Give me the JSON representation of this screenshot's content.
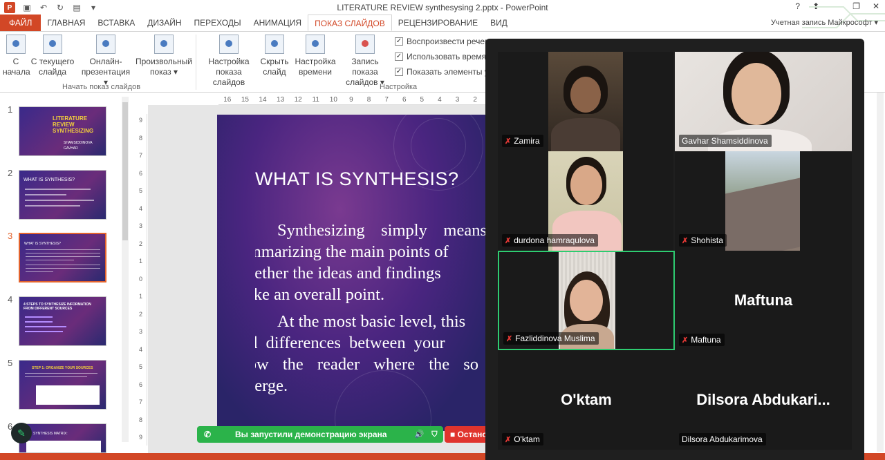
{
  "window": {
    "title": "LITERATURE REVIEW synthesysing 2.pptx - PowerPoint",
    "help": "?",
    "minimize": "—",
    "restore": "❐",
    "close": "✕",
    "logo": "P"
  },
  "tabs": {
    "file": "ФАЙЛ",
    "items": [
      "ГЛАВНАЯ",
      "ВСТАВКА",
      "ДИЗАЙН",
      "ПЕРЕХОДЫ",
      "АНИМАЦИЯ",
      "ПОКАЗ СЛАЙДОВ",
      "РЕЦЕНЗИРОВАНИЕ",
      "ВИД"
    ],
    "account": "Учетная запись Майкрософт ▾"
  },
  "ribbon": {
    "start": {
      "line1": "С",
      "line2": "начала"
    },
    "current": {
      "line1": "С текущего",
      "line2": "слайда"
    },
    "online": {
      "line1": "Онлайн-",
      "line2": "презентация ▾"
    },
    "custom": {
      "line1": "Произвольный",
      "line2": "показ ▾"
    },
    "setup": {
      "line1": "Настройка",
      "line2": "показа слайдов"
    },
    "hide": {
      "line1": "Скрыть",
      "line2": "слайд"
    },
    "timing": {
      "line1": "Настройка",
      "line2": "времени"
    },
    "record": {
      "line1": "Запись показа",
      "line2": "слайдов ▾"
    },
    "group_start": "Начать показ слайдов",
    "group_setup": "Настройка",
    "check1": "Воспроизвести речевое",
    "check2": "Использовать время",
    "check3": "Показать элементы управления"
  },
  "thumbnails": [
    {
      "num": "1",
      "title": "LITERATURE REVIEW SYNTHESIZING",
      "sub": "SHAMSIDDINOVA GAVHAR"
    },
    {
      "num": "2",
      "title": "WHAT IS SYNTHESIS?"
    },
    {
      "num": "3",
      "title": "WHAT IS SYNTHESIS?"
    },
    {
      "num": "4",
      "title": "4 STEPS TO SYNTHESIZE INFORMATION FROM DIFFERENT SOURCES"
    },
    {
      "num": "5",
      "title": "STEP 1: ORGANIZE YOUR SOURCES"
    },
    {
      "num": "6",
      "title": "SYNTHESIS MATRIX:"
    }
  ],
  "ruler": {
    "h": [
      "16",
      "15",
      "14",
      "13",
      "12",
      "11",
      "10",
      "9",
      "8",
      "7",
      "6",
      "5",
      "4",
      "3",
      "2"
    ],
    "v": [
      "9",
      "8",
      "7",
      "6",
      "5",
      "4",
      "3",
      "2",
      "1",
      "0",
      "1",
      "2",
      "3",
      "4",
      "5",
      "6",
      "7",
      "8",
      "9"
    ]
  },
  "slide": {
    "title": "WHAT IS SYNTHESIS?",
    "para1": [
      "Synthesizing simply means",
      "summarizing the main points of",
      "together the ideas and findings",
      "make an overall point."
    ],
    "para2": [
      "At the most basic level, this",
      "and differences between your",
      "show the reader where the so",
      "diverge."
    ]
  },
  "share": {
    "message": "Вы запустили демонстрацию экрана",
    "stop": "Остановить"
  },
  "participants": [
    {
      "name": "Zamira",
      "muted": true
    },
    {
      "name": "Gavhar Shamsiddinova",
      "muted": false
    },
    {
      "name": "durdona hamraqulova",
      "muted": true
    },
    {
      "name": "Shohista",
      "muted": true
    },
    {
      "name": "Fazliddinova Muslima",
      "muted": true
    },
    {
      "name": "Maftuna",
      "display": "Maftuna",
      "muted": true
    },
    {
      "name": "O'ktam",
      "display": "O'ktam",
      "muted": true
    },
    {
      "name": "Dilsora Abdukarimova",
      "display": "Dilsora  Abdukari...",
      "muted": false
    }
  ],
  "colors": {
    "accent": "#d24726",
    "share_green": "#2bb34a",
    "active_speaker": "#2ecc71",
    "muted_red": "#e53935"
  }
}
